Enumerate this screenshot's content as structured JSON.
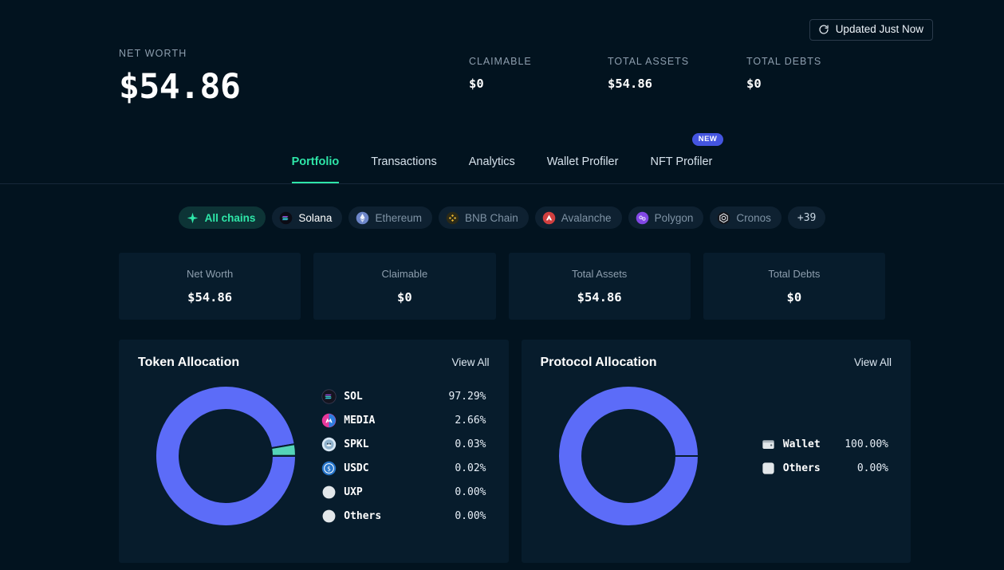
{
  "hero": {
    "refresh_label": "Updated Just Now",
    "refresh_icon": "refresh-icon",
    "net_worth_label": "NET WORTH",
    "net_worth_value": "$54.86",
    "stats": [
      {
        "label": "CLAIMABLE",
        "value": "$0"
      },
      {
        "label": "TOTAL ASSETS",
        "value": "$54.86"
      },
      {
        "label": "TOTAL DEBTS",
        "value": "$0"
      }
    ]
  },
  "tabs": [
    {
      "label": "Portfolio",
      "active": true,
      "badge": ""
    },
    {
      "label": "Transactions",
      "active": false,
      "badge": ""
    },
    {
      "label": "Analytics",
      "active": false,
      "badge": ""
    },
    {
      "label": "Wallet Profiler",
      "active": false,
      "badge": ""
    },
    {
      "label": "NFT Profiler",
      "active": false,
      "badge": "NEW"
    }
  ],
  "chains": [
    {
      "label": "All chains",
      "icon": "sparkle-icon",
      "state": "all"
    },
    {
      "label": "Solana",
      "icon": "solana-icon",
      "state": "sel"
    },
    {
      "label": "Ethereum",
      "icon": "ethereum-icon",
      "state": "off"
    },
    {
      "label": "BNB Chain",
      "icon": "bnb-icon",
      "state": "off"
    },
    {
      "label": "Avalanche",
      "icon": "avalanche-icon",
      "state": "off"
    },
    {
      "label": "Polygon",
      "icon": "polygon-icon",
      "state": "off"
    },
    {
      "label": "Cronos",
      "icon": "cronos-icon",
      "state": "off"
    },
    {
      "label": "+39",
      "icon": "",
      "state": "more"
    }
  ],
  "cards": [
    {
      "label": "Net Worth",
      "value": "$54.86"
    },
    {
      "label": "Claimable",
      "value": "$0"
    },
    {
      "label": "Total Assets",
      "value": "$54.86"
    },
    {
      "label": "Total Debts",
      "value": "$0"
    }
  ],
  "token_panel": {
    "title": "Token Allocation",
    "view_all": "View All"
  },
  "protocol_panel": {
    "title": "Protocol Allocation",
    "view_all": "View All"
  },
  "colors": {
    "page_bg": "#02131f",
    "panel_bg": "#071c2c",
    "accent_green": "#2ee6a8",
    "donut_blue": "#5c6cf8",
    "donut_teal": "#55d4b8",
    "badge_blue": "#4455e0"
  },
  "chart_data": [
    {
      "type": "pie",
      "title": "Token Allocation",
      "legend": "right",
      "categories": [
        "SOL",
        "MEDIA",
        "SPKL",
        "USDC",
        "UXP",
        "Others"
      ],
      "values": [
        97.29,
        2.66,
        0.03,
        0.02,
        0.0,
        0.0
      ],
      "labels": [
        "97.29%",
        "2.66%",
        "0.03%",
        "0.02%",
        "0.00%",
        "0.00%"
      ],
      "colors": [
        "#5c6cf8",
        "#55d4b8",
        "#5c6cf8",
        "#5c6cf8",
        "#5c6cf8",
        "#5c6cf8"
      ],
      "icons": [
        "sol-icon",
        "media-icon",
        "spkl-icon",
        "usdc-icon",
        "uxp-icon",
        "others-icon"
      ]
    },
    {
      "type": "pie",
      "title": "Protocol Allocation",
      "legend": "right",
      "categories": [
        "Wallet",
        "Others"
      ],
      "values": [
        100.0,
        0.0
      ],
      "labels": [
        "100.00%",
        "0.00%"
      ],
      "colors": [
        "#5c6cf8",
        "#dfe5ea"
      ],
      "icons": [
        "wallet-icon",
        "others-icon"
      ]
    }
  ]
}
